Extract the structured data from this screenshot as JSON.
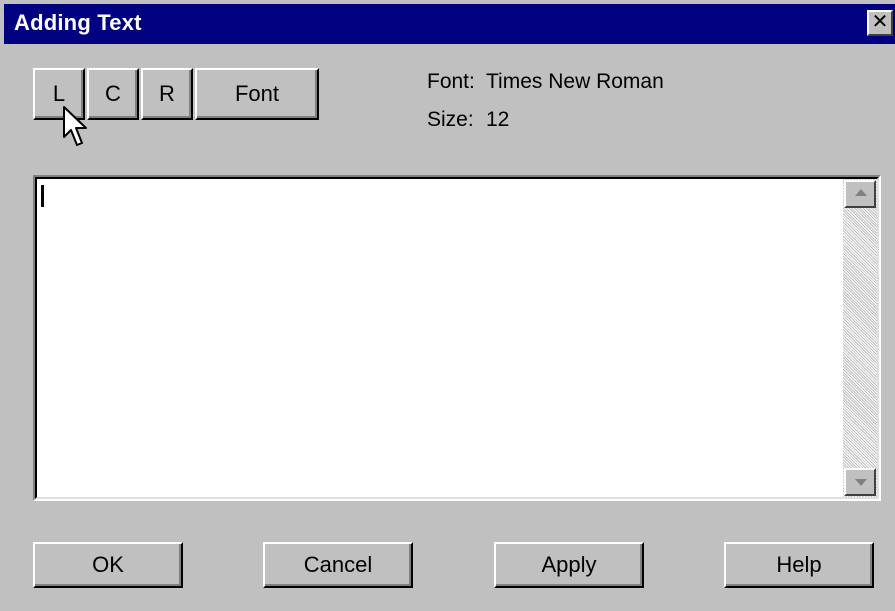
{
  "window": {
    "title": "Adding Text",
    "close_glyph": "✕"
  },
  "toolbar": {
    "align_left_label": "L",
    "align_center_label": "C",
    "align_right_label": "R",
    "font_button_label": "Font"
  },
  "font_info": {
    "font_label": "Font:",
    "font_value": "Times New Roman",
    "size_label": "Size:",
    "size_value": "12"
  },
  "text_area": {
    "value": ""
  },
  "buttons": {
    "ok": "OK",
    "cancel": "Cancel",
    "apply": "Apply",
    "help": "Help"
  },
  "colors": {
    "title_bar": "#000080",
    "face": "#c0c0c0",
    "edit_background": "#ffffff"
  },
  "icons": {
    "close": "close-icon",
    "scroll_up": "scroll-up-arrow-icon",
    "scroll_down": "scroll-down-arrow-icon",
    "pointer": "mouse-pointer-icon"
  }
}
